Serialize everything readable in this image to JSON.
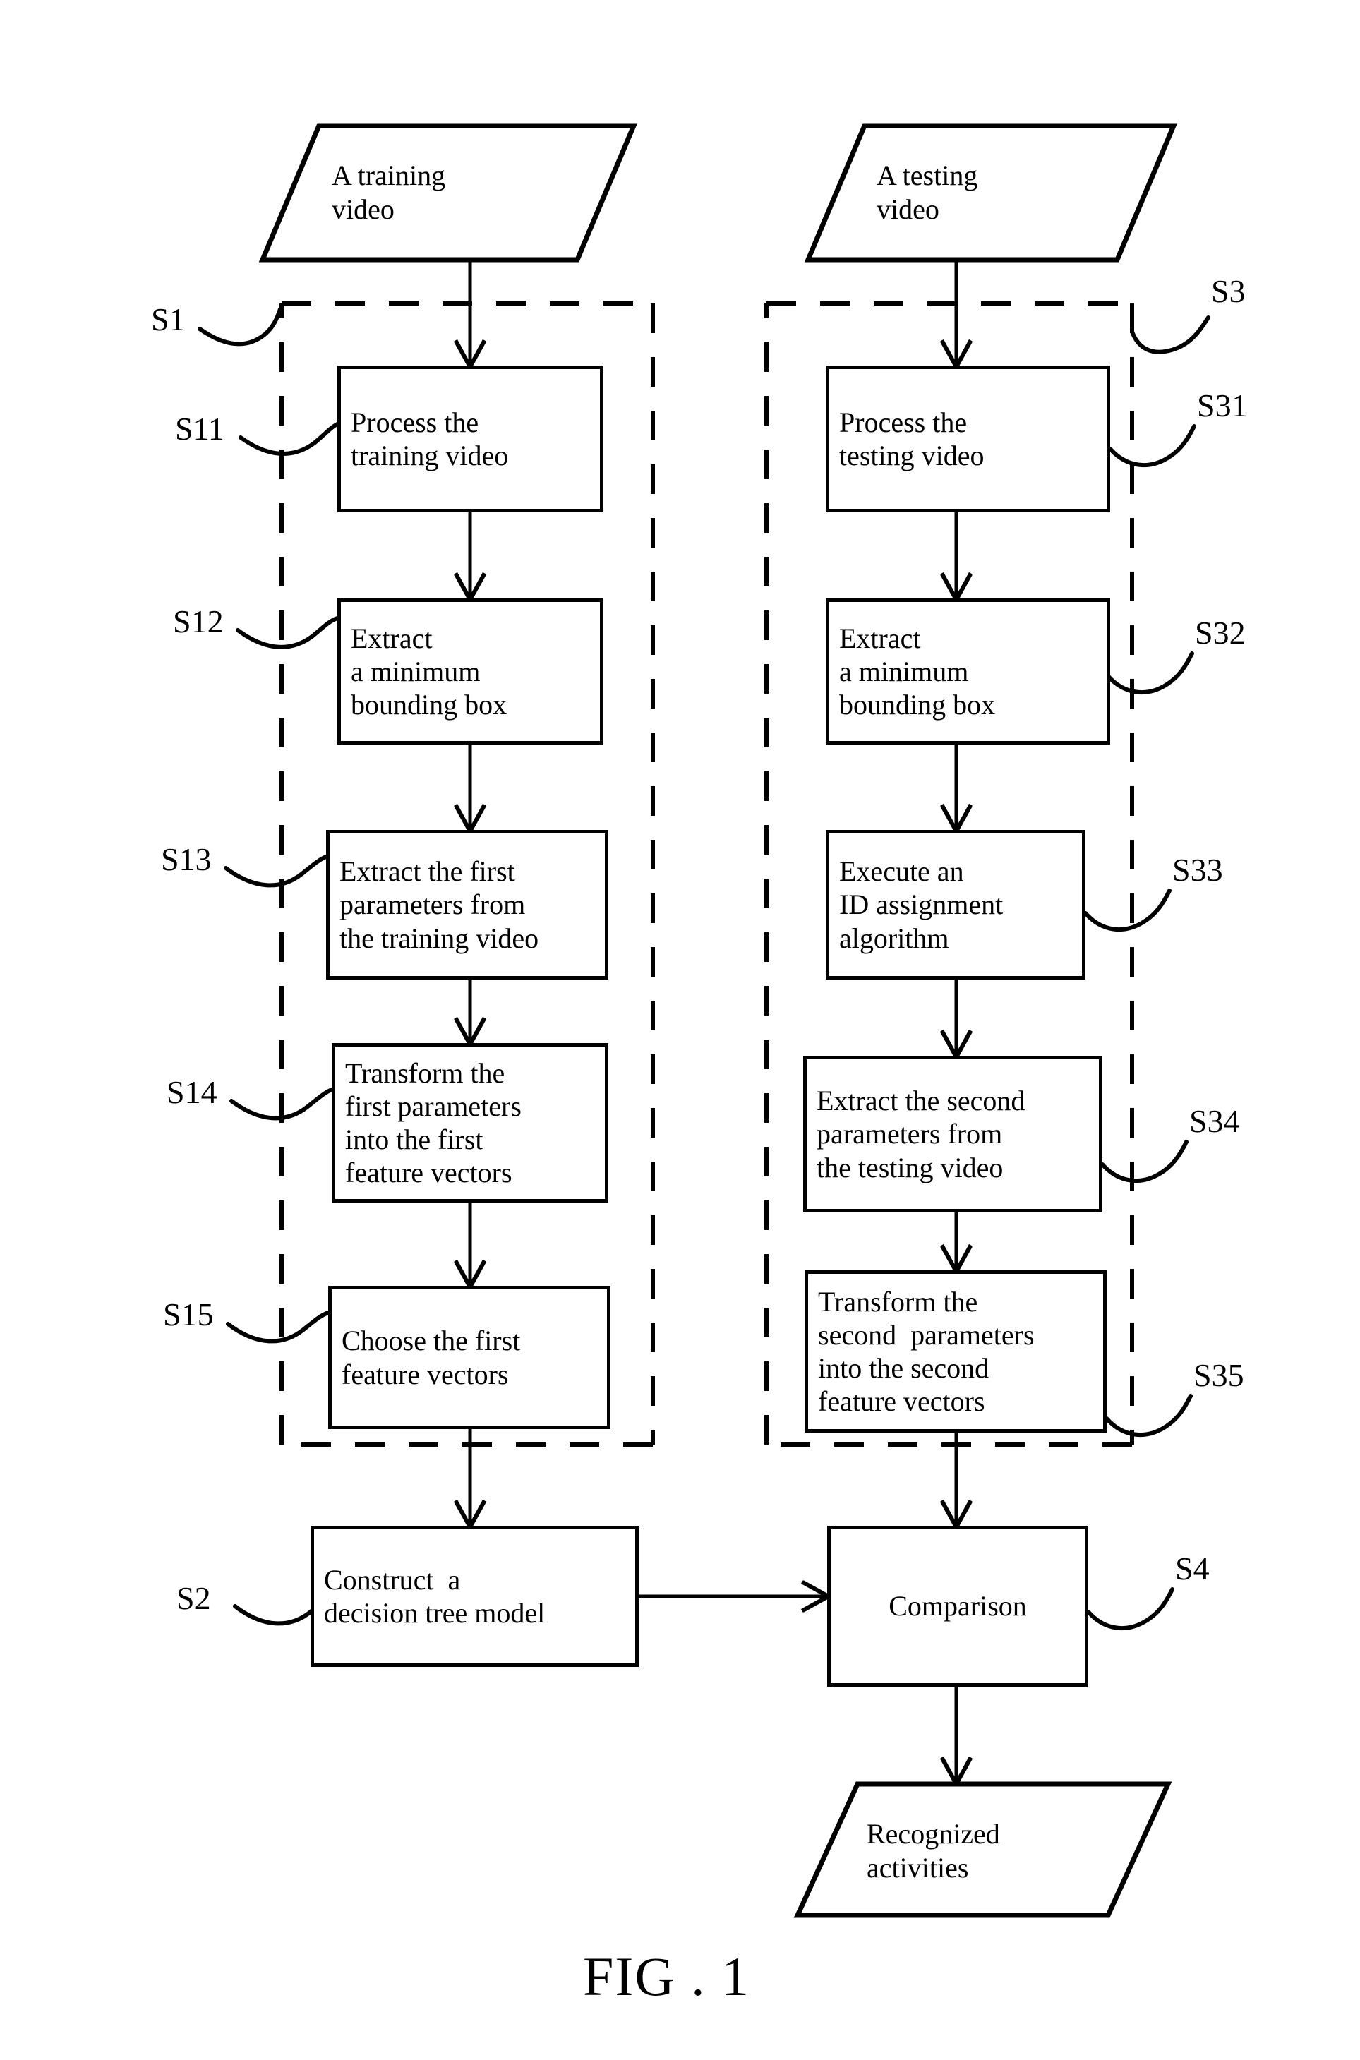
{
  "figure": {
    "caption": "FIG . 1"
  },
  "io_nodes": [
    {
      "id": "training-video",
      "lines": [
        "A training",
        "video"
      ]
    },
    {
      "id": "testing-video",
      "lines": [
        "A testing",
        "video"
      ]
    },
    {
      "id": "recognized-activities",
      "lines": [
        "Recognized",
        "activities"
      ]
    }
  ],
  "left_column": {
    "group_label": "S1",
    "steps": [
      {
        "label": "S11",
        "lines": [
          "Process the",
          "training video"
        ]
      },
      {
        "label": "S12",
        "lines": [
          "Extract",
          "a minimum",
          "bounding box"
        ]
      },
      {
        "label": "S13",
        "lines": [
          "Extract the first",
          "parameters from",
          "the training video"
        ]
      },
      {
        "label": "S14",
        "lines": [
          "Transform the",
          "first parameters",
          "into the first",
          "feature vectors"
        ]
      },
      {
        "label": "S15",
        "lines": [
          "Choose the first",
          "feature vectors"
        ]
      }
    ]
  },
  "right_column": {
    "group_label": "S3",
    "steps": [
      {
        "label": "S31",
        "lines": [
          "Process the",
          "testing video"
        ]
      },
      {
        "label": "S32",
        "lines": [
          "Extract",
          "a minimum",
          "bounding box"
        ]
      },
      {
        "label": "S33",
        "lines": [
          "Execute an",
          "ID assignment",
          "algorithm"
        ]
      },
      {
        "label": "S34",
        "lines": [
          "Extract the second",
          "parameters from",
          "the testing video"
        ]
      },
      {
        "label": "S35",
        "lines": [
          "Transform the",
          "second  parameters",
          "into the second",
          "feature vectors"
        ]
      }
    ]
  },
  "bottom_steps": [
    {
      "label": "S2",
      "id": "construct-decision-tree",
      "lines": [
        "Construct  a",
        "decision tree model"
      ]
    },
    {
      "label": "S4",
      "id": "comparison",
      "lines": [
        "Comparison"
      ]
    }
  ],
  "colors": {
    "stroke": "#000000",
    "background": "#ffffff"
  }
}
